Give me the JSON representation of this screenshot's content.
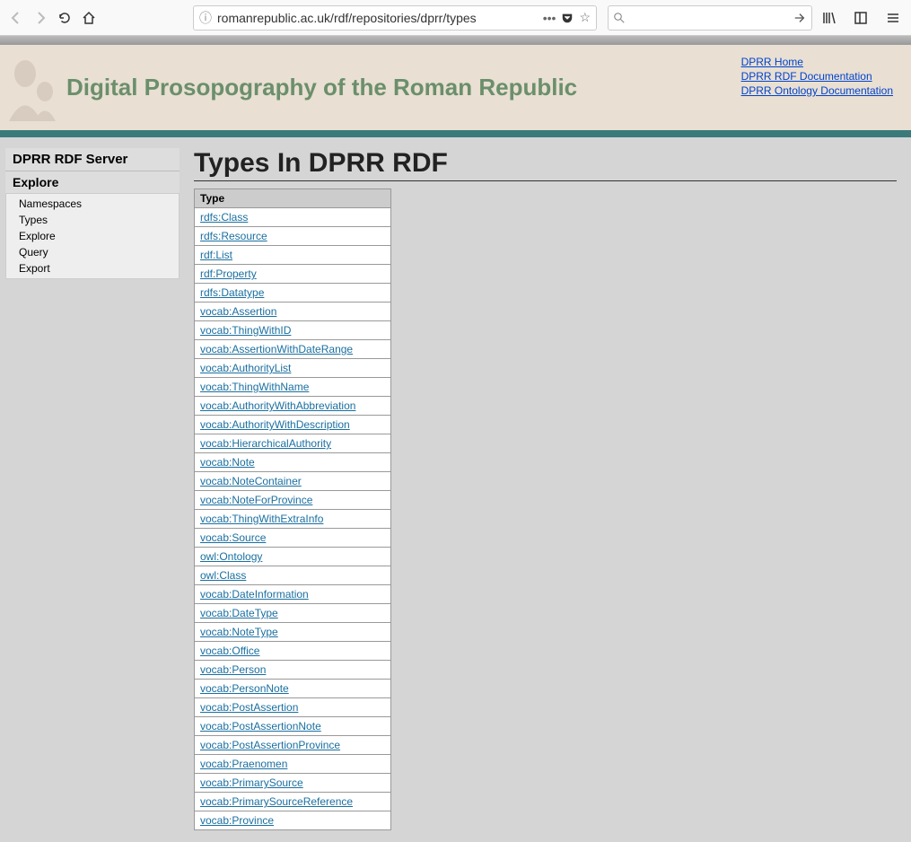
{
  "browser": {
    "url": "romanrepublic.ac.uk/rdf/repositories/dprr/types"
  },
  "header": {
    "site_title": "Digital Prosopography of the Roman Republic",
    "links": [
      "DPRR Home",
      "DPRR RDF Documentation",
      "DPRR Ontology Documentation"
    ]
  },
  "sidebar": {
    "title": "DPRR RDF Server",
    "section": "Explore",
    "items": [
      "Namespaces",
      "Types",
      "Explore",
      "Query",
      "Export"
    ]
  },
  "page": {
    "title": "Types In DPRR RDF",
    "table_header": "Type",
    "types": [
      "rdfs:Class",
      "rdfs:Resource",
      "rdf:List",
      "rdf:Property",
      "rdfs:Datatype",
      "vocab:Assertion",
      "vocab:ThingWithID",
      "vocab:AssertionWithDateRange",
      "vocab:AuthorityList",
      "vocab:ThingWithName",
      "vocab:AuthorityWithAbbreviation",
      "vocab:AuthorityWithDescription",
      "vocab:HierarchicalAuthority",
      "vocab:Note",
      "vocab:NoteContainer",
      "vocab:NoteForProvince",
      "vocab:ThingWithExtraInfo",
      "vocab:Source",
      "owl:Ontology",
      "owl:Class",
      "vocab:DateInformation",
      "vocab:DateType",
      "vocab:NoteType",
      "vocab:Office",
      "vocab:Person",
      "vocab:PersonNote",
      "vocab:PostAssertion",
      "vocab:PostAssertionNote",
      "vocab:PostAssertionProvince",
      "vocab:Praenomen",
      "vocab:PrimarySource",
      "vocab:PrimarySourceReference",
      "vocab:Province"
    ]
  }
}
